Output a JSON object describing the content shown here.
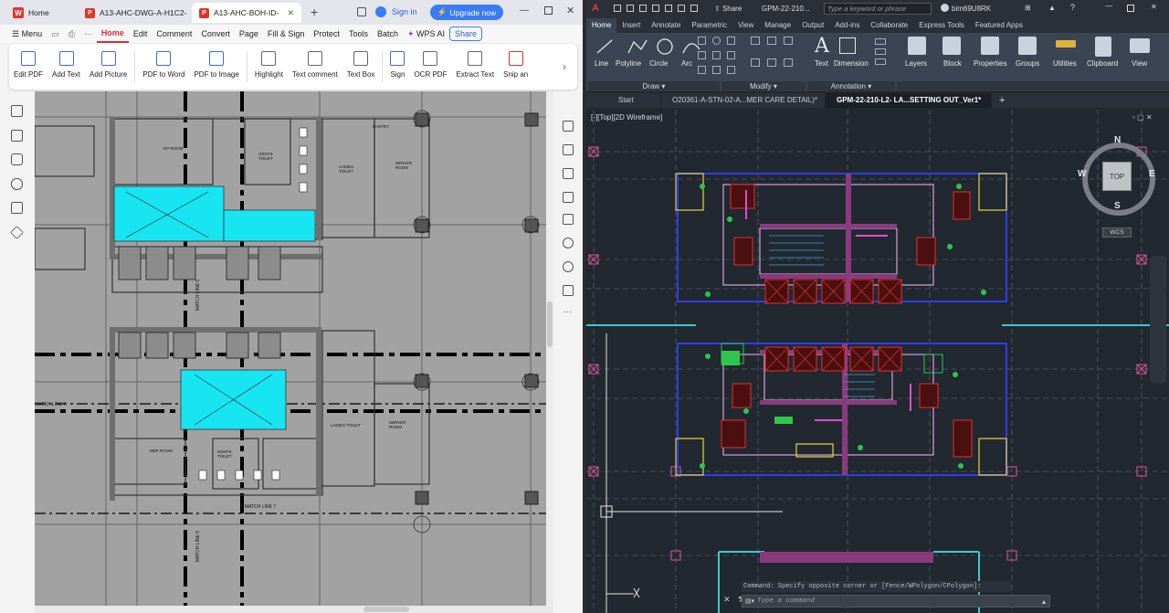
{
  "wps": {
    "tabs": [
      {
        "label": "Home"
      },
      {
        "label": "A13-AHC-DWG-A-H1C2-"
      },
      {
        "label": "A13-AHC-BOH-ID-"
      }
    ],
    "sign_in": "Sign in",
    "upgrade": "Upgrade now",
    "menu_label": "Menu",
    "menu_items": [
      "Home",
      "Edit",
      "Comment",
      "Convert",
      "Page",
      "Fill & Sign",
      "Protect",
      "Tools",
      "Batch"
    ],
    "wps_ai": "WPS AI",
    "share": "Share",
    "ribbon": [
      "Edit PDF",
      "Add Text",
      "Add Picture",
      "PDF to Word",
      "PDF to Image",
      "Highlight",
      "Text comment",
      "Text Box",
      "Sign",
      "OCR PDF",
      "Extract Text",
      "Snip an"
    ],
    "drawing_labels": {
      "vip_room": "VIP ROOM",
      "gents_toilet": "GENTS TOILET",
      "ladies_toilet": "LADIES TOILET",
      "server_room": "SERVER ROOM",
      "match_line_5": "MATCH LINE 5",
      "match_line_7": "MATCH LINE 7",
      "mep_room": "MEP ROOM",
      "pantry": "PANTRY",
      "match_line": "MATCH LINE 7"
    }
  },
  "cad": {
    "title": "GPM-22-210...",
    "share": "Share",
    "search_placeholder": "Type a keyword or phrase",
    "user": "bim69U8RK",
    "tabs": [
      "Home",
      "Insert",
      "Annotate",
      "Parametric",
      "View",
      "Manage",
      "Output",
      "Add-ins",
      "Collaborate",
      "Express Tools",
      "Featured Apps"
    ],
    "draw_tools": [
      "Line",
      "Polyline",
      "Circle",
      "Arc"
    ],
    "annotation_tools": [
      "Text",
      "Dimension"
    ],
    "big_tools": [
      "Layers",
      "Block",
      "Properties",
      "Groups",
      "Utilities",
      "Clipboard",
      "View"
    ],
    "groups": [
      "Draw",
      "Modify",
      "Annotation"
    ],
    "doc_tabs": [
      "Start",
      "O20361-A-STN-02-A...MER CARE DETAIL)*",
      "GPM-22-210-L2- LA...SETTING OUT_Ver1*"
    ],
    "viewport_label": "[-][Top][2D Wireframe]",
    "viewcube": {
      "n": "N",
      "s": "S",
      "e": "E",
      "w": "W",
      "top": "TOP",
      "wcs": "WCS"
    },
    "command_history": "Command: Specify opposite corner or [Fence/WPolygon/CPolygon]:",
    "command_placeholder": "Type a command"
  },
  "colors": {
    "wps_red": "#d43232",
    "upgrade_blue": "#3b7cf5",
    "cyan_fill": "#17e5f2",
    "cad_bg": "#212830"
  }
}
